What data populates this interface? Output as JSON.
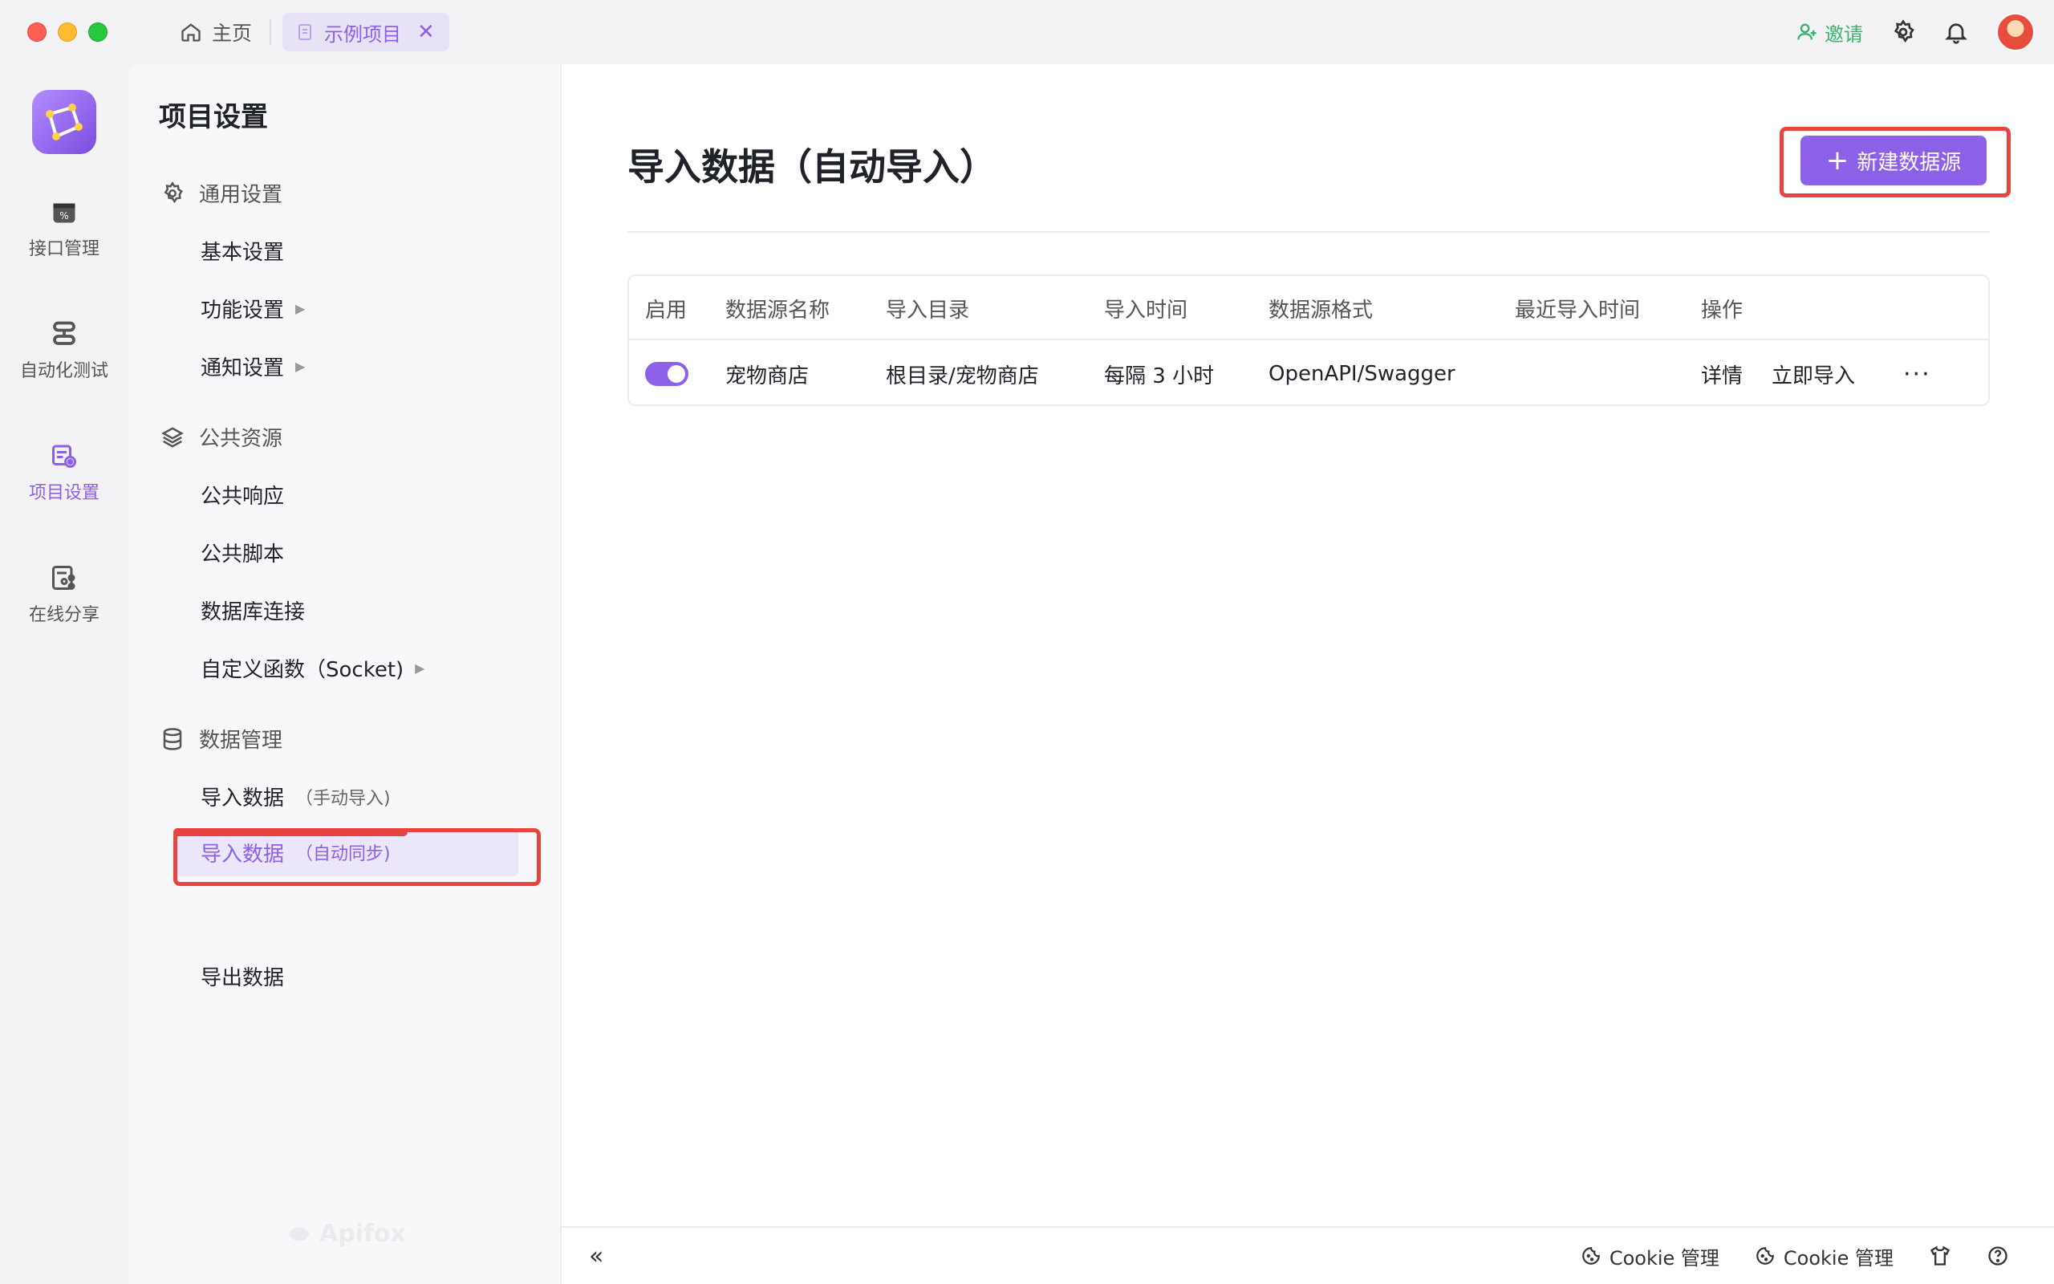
{
  "titlebar": {
    "home_tab_label": "主页",
    "project_tab_label": "示例项目",
    "close_glyph": "✕",
    "invite_label": "邀请"
  },
  "rail": {
    "items": [
      {
        "label": "接口管理",
        "icon": "api-management-icon"
      },
      {
        "label": "自动化测试",
        "icon": "automation-test-icon"
      },
      {
        "label": "项目设置",
        "icon": "project-settings-icon",
        "active": true
      },
      {
        "label": "在线分享",
        "icon": "online-share-icon"
      }
    ]
  },
  "sidebar": {
    "title": "项目设置",
    "groups": [
      {
        "label": "通用设置",
        "icon": "gear-icon"
      },
      {
        "label": "公共资源",
        "icon": "layers-icon"
      },
      {
        "label": "数据管理",
        "icon": "database-icon"
      }
    ],
    "items": {
      "basic": "基本设置",
      "feature": "功能设置",
      "notify": "通知设置",
      "common_response": "公共响应",
      "common_script": "公共脚本",
      "db_conn": "数据库连接",
      "custom_func": "自定义函数（Socket)",
      "import_manual": "导入数据",
      "import_manual_sub": "（手动导入)",
      "import_auto": "导入数据",
      "import_auto_sub": "（自动同步)",
      "export": "导出数据"
    },
    "watermark": "Apifox"
  },
  "main": {
    "title": "导入数据（自动导入）",
    "new_button": "新建数据源",
    "table": {
      "headers": [
        "启用",
        "数据源名称",
        "导入目录",
        "导入时间",
        "数据源格式",
        "最近导入时间",
        "操作"
      ],
      "rows": [
        {
          "enabled": true,
          "name": "宠物商店",
          "directory": "根目录/宠物商店",
          "time": "每隔 3 小时",
          "format": "OpenAPI/Swagger",
          "last_import": "",
          "action_detail": "详情",
          "action_import": "立即导入",
          "action_more": "···"
        }
      ]
    }
  },
  "footer": {
    "cookie_1": "Cookie 管理",
    "cookie_2": "Cookie 管理"
  },
  "colors": {
    "accent": "#8c61e8",
    "highlight": "#e8443f",
    "invite": "#3ab46f"
  }
}
